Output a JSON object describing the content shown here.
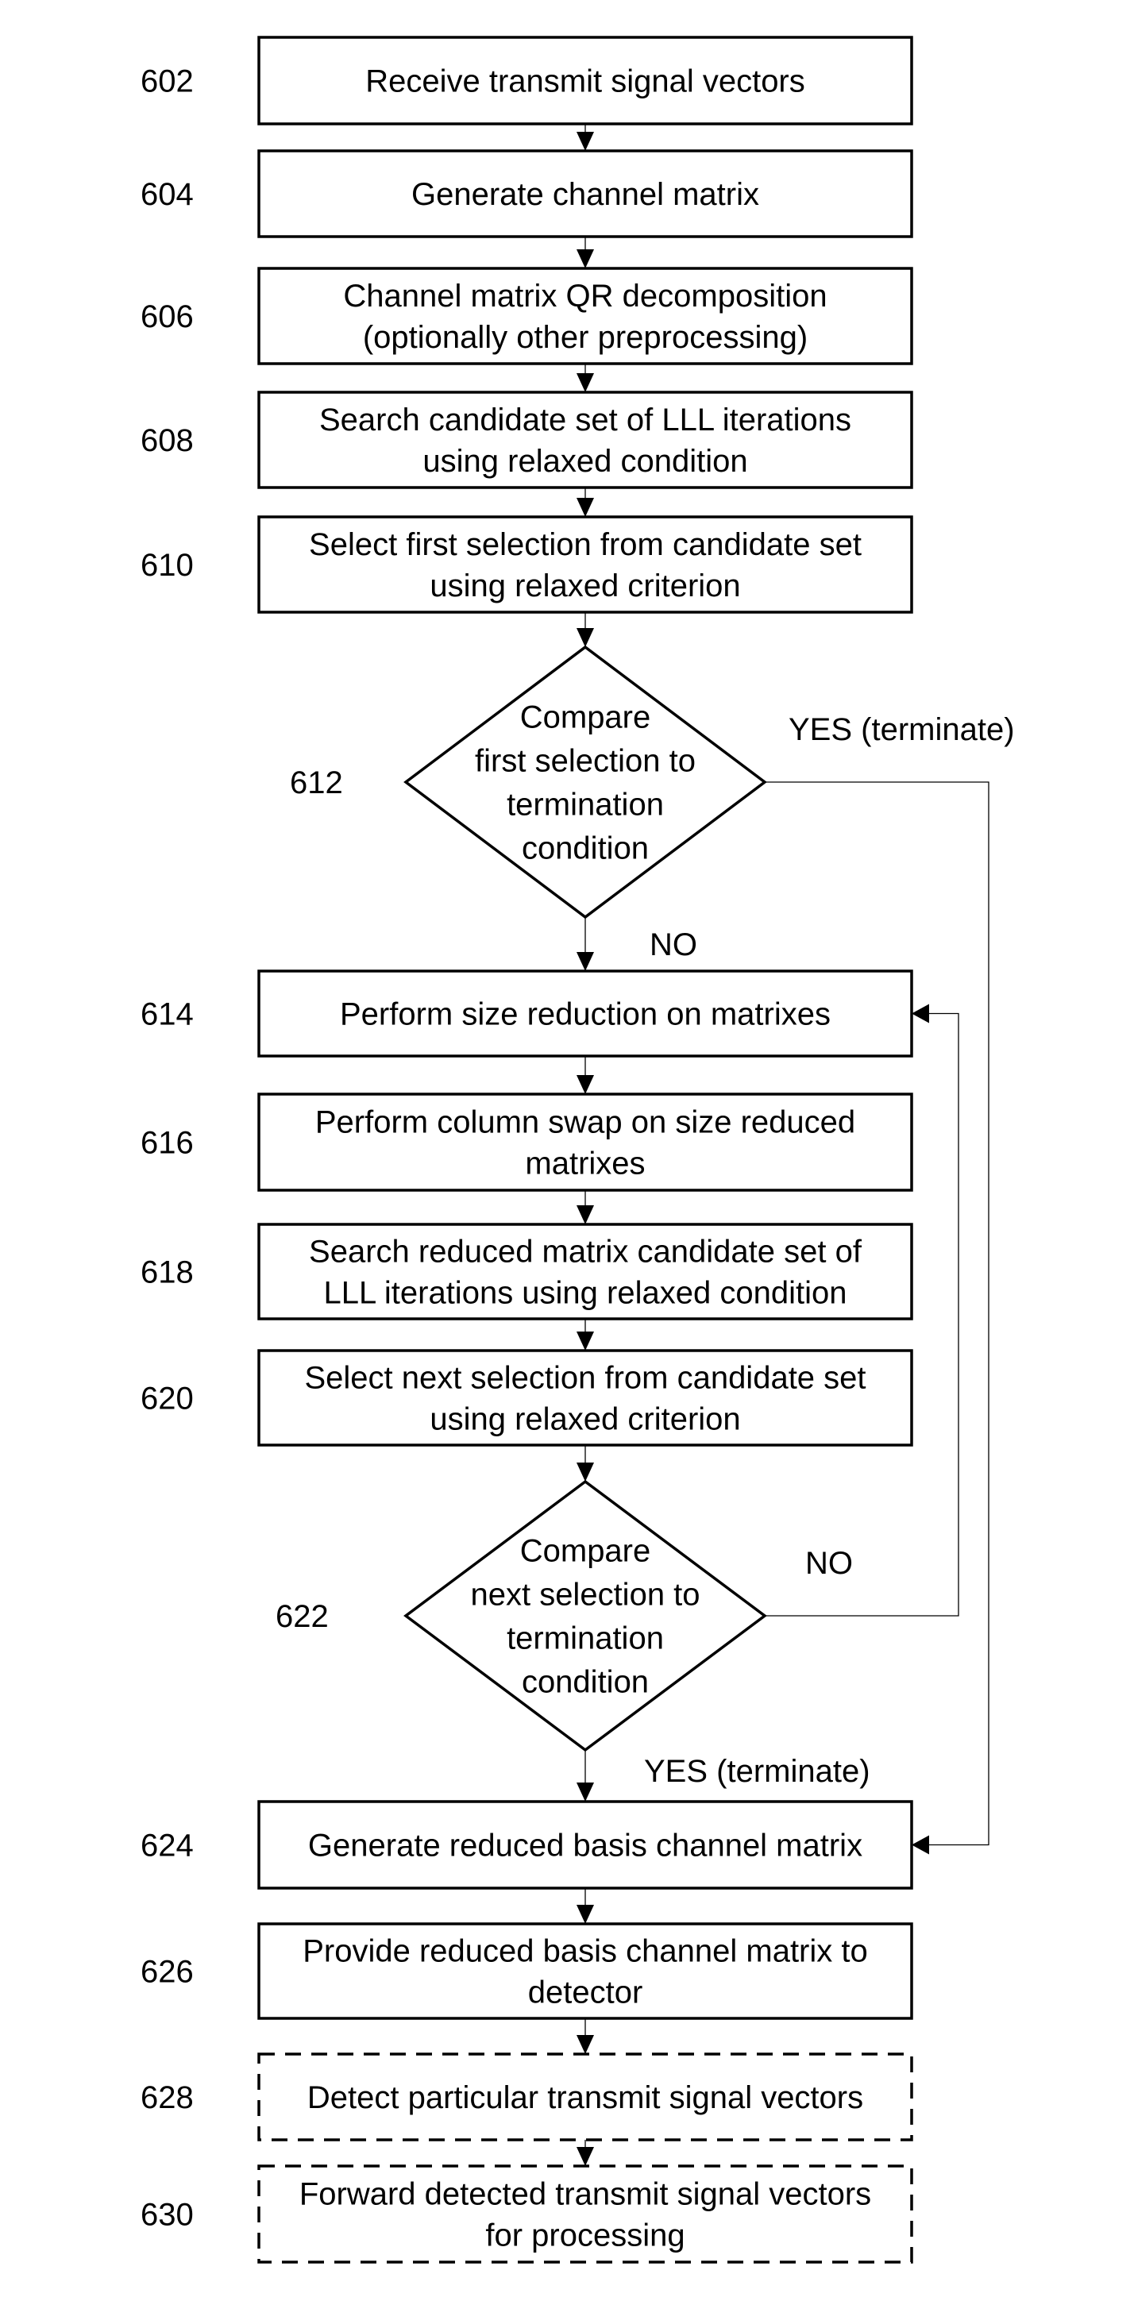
{
  "figure": {
    "type": "flowchart",
    "steps": [
      {
        "id": "602",
        "kind": "process",
        "style": "solid",
        "lines": [
          "Receive transmit signal vectors"
        ]
      },
      {
        "id": "604",
        "kind": "process",
        "style": "solid",
        "lines": [
          "Generate channel matrix"
        ]
      },
      {
        "id": "606",
        "kind": "process",
        "style": "solid",
        "lines": [
          "Channel matrix QR decomposition",
          "(optionally other preprocessing)"
        ]
      },
      {
        "id": "608",
        "kind": "process",
        "style": "solid",
        "lines": [
          "Search candidate set of LLL iterations",
          "using relaxed condition"
        ]
      },
      {
        "id": "610",
        "kind": "process",
        "style": "solid",
        "lines": [
          "Select first selection from candidate set",
          "using relaxed criterion"
        ]
      },
      {
        "id": "612",
        "kind": "decision",
        "style": "solid",
        "lines": [
          "Compare",
          "first selection to",
          "termination",
          "condition"
        ]
      },
      {
        "id": "614",
        "kind": "process",
        "style": "solid",
        "lines": [
          "Perform size reduction on matrixes"
        ]
      },
      {
        "id": "616",
        "kind": "process",
        "style": "solid",
        "lines": [
          "Perform column swap on size reduced",
          "matrixes"
        ]
      },
      {
        "id": "618",
        "kind": "process",
        "style": "solid",
        "lines": [
          "Search reduced matrix candidate set of",
          "LLL iterations using relaxed condition"
        ]
      },
      {
        "id": "620",
        "kind": "process",
        "style": "solid",
        "lines": [
          "Select next selection from candidate set",
          "using relaxed criterion"
        ]
      },
      {
        "id": "622",
        "kind": "decision",
        "style": "solid",
        "lines": [
          "Compare",
          "next selection to",
          "termination",
          "condition"
        ]
      },
      {
        "id": "624",
        "kind": "process",
        "style": "solid",
        "lines": [
          "Generate reduced basis channel matrix"
        ]
      },
      {
        "id": "626",
        "kind": "process",
        "style": "solid",
        "lines": [
          "Provide reduced basis channel matrix to",
          "detector"
        ]
      },
      {
        "id": "628",
        "kind": "process",
        "style": "dashed",
        "lines": [
          "Detect particular transmit signal vectors"
        ]
      },
      {
        "id": "630",
        "kind": "process",
        "style": "dashed",
        "lines": [
          "Forward detected transmit signal vectors",
          "for processing"
        ]
      }
    ],
    "branches": {
      "d612_yes": "YES (terminate)",
      "d612_no": "NO",
      "d622_no": "NO",
      "d622_yes": "YES (terminate)"
    },
    "edges": [
      {
        "from": "602",
        "to": "604"
      },
      {
        "from": "604",
        "to": "606"
      },
      {
        "from": "606",
        "to": "608"
      },
      {
        "from": "608",
        "to": "610"
      },
      {
        "from": "610",
        "to": "612"
      },
      {
        "from": "612",
        "to": "614",
        "label": "NO"
      },
      {
        "from": "612",
        "to": "624",
        "label": "YES (terminate)"
      },
      {
        "from": "614",
        "to": "616"
      },
      {
        "from": "616",
        "to": "618"
      },
      {
        "from": "618",
        "to": "620"
      },
      {
        "from": "620",
        "to": "622"
      },
      {
        "from": "622",
        "to": "614",
        "label": "NO"
      },
      {
        "from": "622",
        "to": "624",
        "label": "YES (terminate)"
      },
      {
        "from": "624",
        "to": "626"
      },
      {
        "from": "626",
        "to": "628"
      },
      {
        "from": "628",
        "to": "630"
      }
    ]
  }
}
